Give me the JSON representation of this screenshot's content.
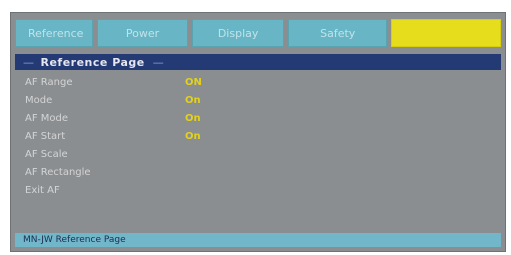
{
  "tabs": [
    {
      "label": "Reference"
    },
    {
      "label": "Power"
    },
    {
      "label": "Display"
    },
    {
      "label": "Safety"
    },
    {
      "label": ""
    }
  ],
  "page_title": "Reference Page",
  "settings": [
    {
      "label": "AF Range",
      "value": "ON"
    },
    {
      "label": "Mode",
      "value": "On"
    },
    {
      "label": "AF Mode",
      "value": "On"
    },
    {
      "label": "AF Start",
      "value": "On"
    },
    {
      "label": "AF Scale",
      "value": ""
    },
    {
      "label": "AF Rectangle",
      "value": ""
    },
    {
      "label": "Exit AF",
      "value": ""
    }
  ],
  "status_text": "MN-JW Reference Page"
}
